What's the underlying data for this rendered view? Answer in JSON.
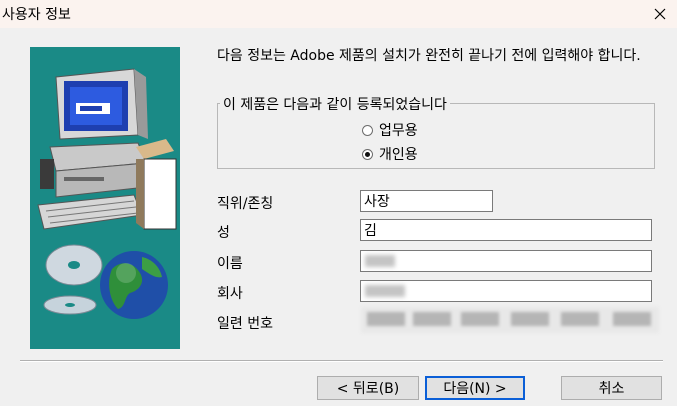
{
  "window": {
    "title": "사용자 정보",
    "close_icon": "close-icon"
  },
  "intro_text": "다음 정보는 Adobe 제품의 설치가 완전히 끝나기 전에 입력해야 합니다.",
  "registration": {
    "legend": "이 제품은 다음과 같이 등록되었습니다",
    "options": [
      {
        "label": "업무용",
        "selected": false
      },
      {
        "label": "개인용",
        "selected": true
      }
    ]
  },
  "fields": {
    "title": {
      "label": "직위/존칭",
      "value": "사장"
    },
    "last_name": {
      "label": "성",
      "value": "김"
    },
    "first_name": {
      "label": "이름",
      "value": ""
    },
    "company": {
      "label": "회사",
      "value": ""
    },
    "serial": {
      "label": "일련 번호"
    }
  },
  "buttons": {
    "back": "< 뒤로(B)",
    "next": "다음(N) >",
    "cancel": "취소"
  },
  "colors": {
    "art_background": "#1a8a86",
    "default_button_border": "#0b5fd7"
  }
}
